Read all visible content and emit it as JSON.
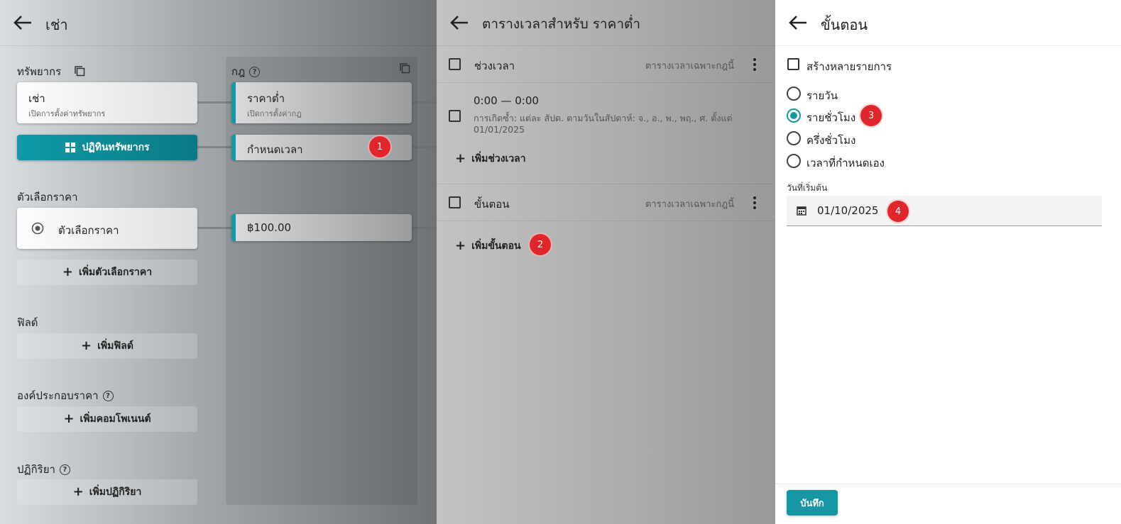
{
  "colors": {
    "accent": "#1597a4",
    "badge": "#e0262b"
  },
  "panel1": {
    "title": "เช่า",
    "resources_label": "ทรัพยากร",
    "resource_card": {
      "title": "เช่า",
      "subtitle": "เปิดการตั้งค่าทรัพยากร"
    },
    "calendar_button": "ปฏิทินทรัพยากร",
    "price_options_label": "ตัวเลือกราคา",
    "price_option_card": "ตัวเลือกราคา",
    "add_price_option": "เพิ่มตัวเลือกราคา",
    "fields_label": "ฟิลด์",
    "add_field": "เพิ่มฟิลด์",
    "components_label": "องค์ประกอบราคา",
    "add_component": "เพิ่มคอมโพเนนต์",
    "actions_label": "ปฏิกิริยา",
    "add_action": "เพิ่มปฏิกิริยา",
    "rules_label": "กฎ",
    "rule_card": {
      "title": "ราคาต่ำ",
      "subtitle": "เปิดการตั้งค่ากฎ"
    },
    "schedule_card": "กำหนดเวลา",
    "price_card": "฿100.00"
  },
  "panel2": {
    "title": "ตารางเวลาสำหรับ ราคาต่ำ",
    "intervals": {
      "title": "ช่วงเวลา",
      "meta": "ตารางเวลาเฉพาะกฎนี้"
    },
    "interval_item": {
      "time": "0:00 — 0:00",
      "desc_line1": "การเกิดซ้ำ: แต่ละ สัปด. ตามวันในสัปดาห์: จ., อ., พ., พฤ., ศ. ตั้งแต่",
      "desc_line2": "01/01/2025"
    },
    "add_interval": "เพิ่มช่วงเวลา",
    "steps": {
      "title": "ขั้นตอน",
      "meta": "ตารางเวลาเฉพาะกฎนี้"
    },
    "add_step": "เพิ่มขั้นตอน"
  },
  "panel3": {
    "title": "ขั้นตอน",
    "create_multiple": "สร้างหลายรายการ",
    "options": [
      "รายวัน",
      "รายชั่วโมง",
      "ครึ่งชั่วโมง",
      "เวลาที่กำหนดเอง"
    ],
    "selected_option": "รายชั่วโมง",
    "start_date_label": "วันที่เริ่มต้น",
    "start_date_value": "01/10/2025",
    "save_label": "บันทึก"
  },
  "badges": [
    "1",
    "2",
    "3",
    "4"
  ]
}
